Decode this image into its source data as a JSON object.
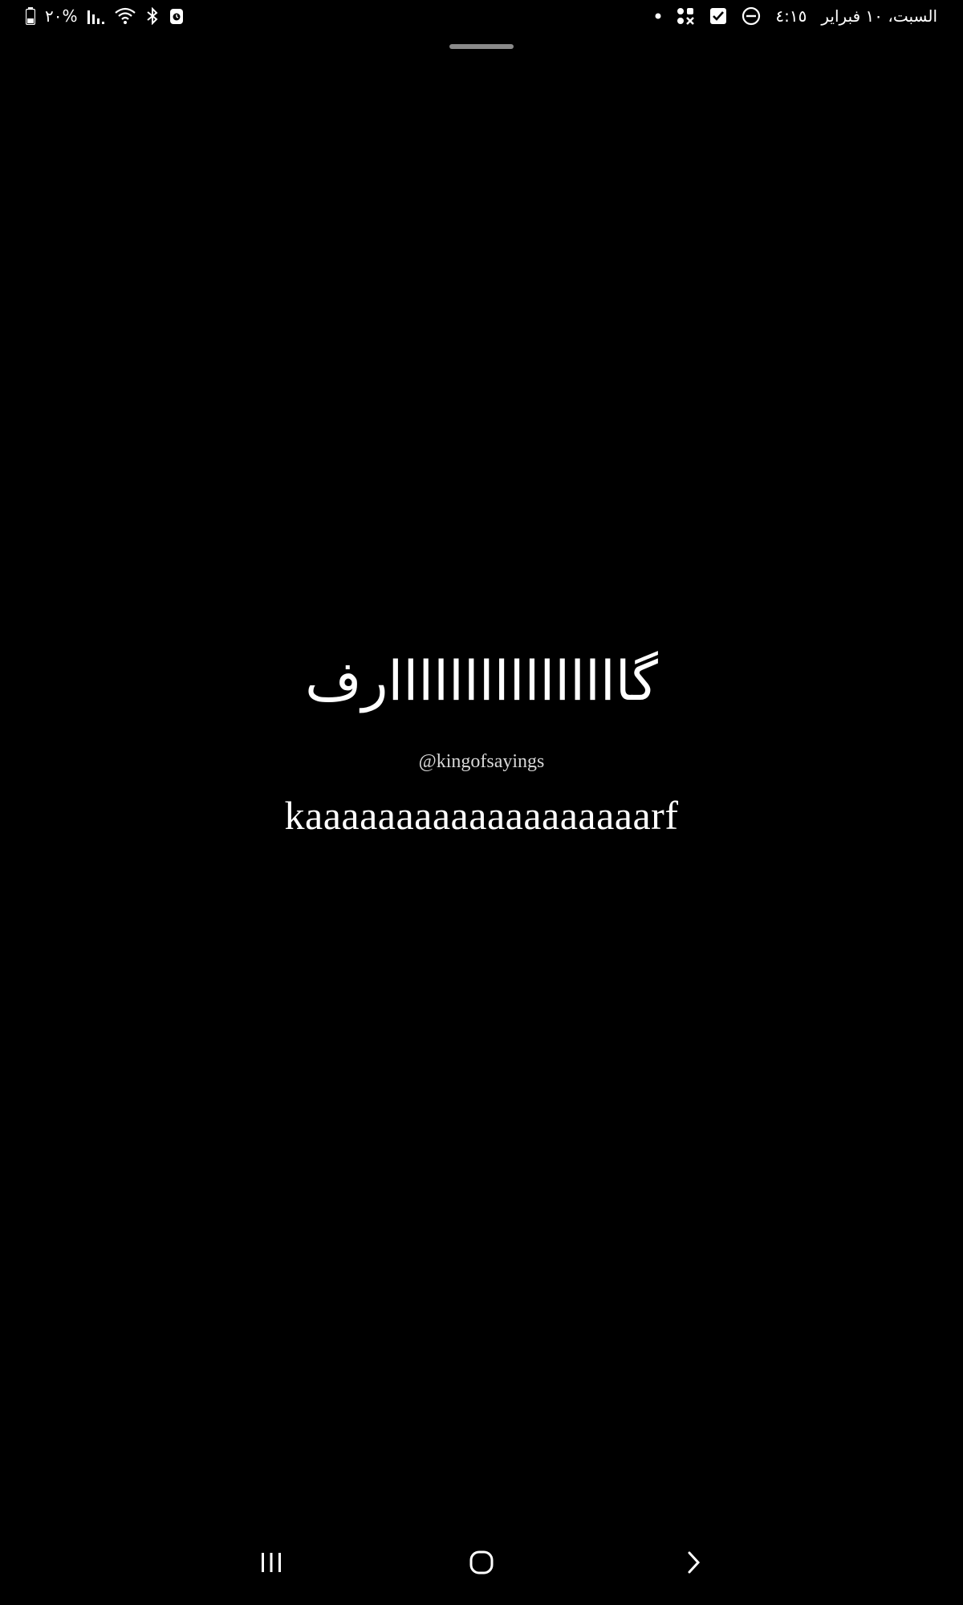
{
  "status_bar": {
    "battery_text": "٢٠%",
    "date_text": "السبت، ١٠ فبراير",
    "time_text": "٤:١٥",
    "icons_left": [
      "battery-icon",
      "signal-icon",
      "wifi-icon",
      "bluetooth-icon",
      "alarm-icon"
    ],
    "icons_right": [
      "dot-icon",
      "apps-icon",
      "checkbox-icon",
      "dnd-icon"
    ]
  },
  "content": {
    "arabic_word": "گاااااااااااااااارف",
    "handle": "@kingofsayings",
    "latin_word": "kaaaaaaaaaaaaaaaaaaarf"
  },
  "nav_bar": {
    "buttons": [
      "recents-icon",
      "home-icon",
      "back-icon"
    ]
  }
}
